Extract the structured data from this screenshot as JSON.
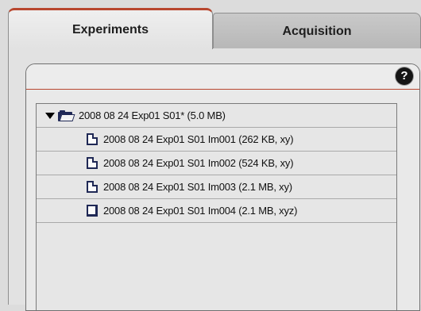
{
  "tabs": [
    {
      "label": "Experiments",
      "active": true
    },
    {
      "label": "Acquisition",
      "active": false
    }
  ],
  "help_icon": "help-icon",
  "tree": {
    "root": {
      "label": "2008 08 24 Exp01 S01*  (5.0 MB)",
      "icon": "folder-open-icon",
      "expanded": true
    },
    "items": [
      {
        "label": "2008 08 24 Exp01 S01 Im001 (262 KB, xy)",
        "icon": "file-icon"
      },
      {
        "label": "2008 08 24 Exp01 S01 Im002 (524 KB, xy)",
        "icon": "file-icon"
      },
      {
        "label": "2008 08 24 Exp01 S01 Im003 (2.1 MB, xy)",
        "icon": "file-icon"
      },
      {
        "label": "2008 08 24 Exp01 S01 Im004 (2.1 MB, xyz)",
        "icon": "stack-file-icon"
      }
    ]
  },
  "colors": {
    "accent": "#b8472f",
    "icon": "#1f2855"
  }
}
